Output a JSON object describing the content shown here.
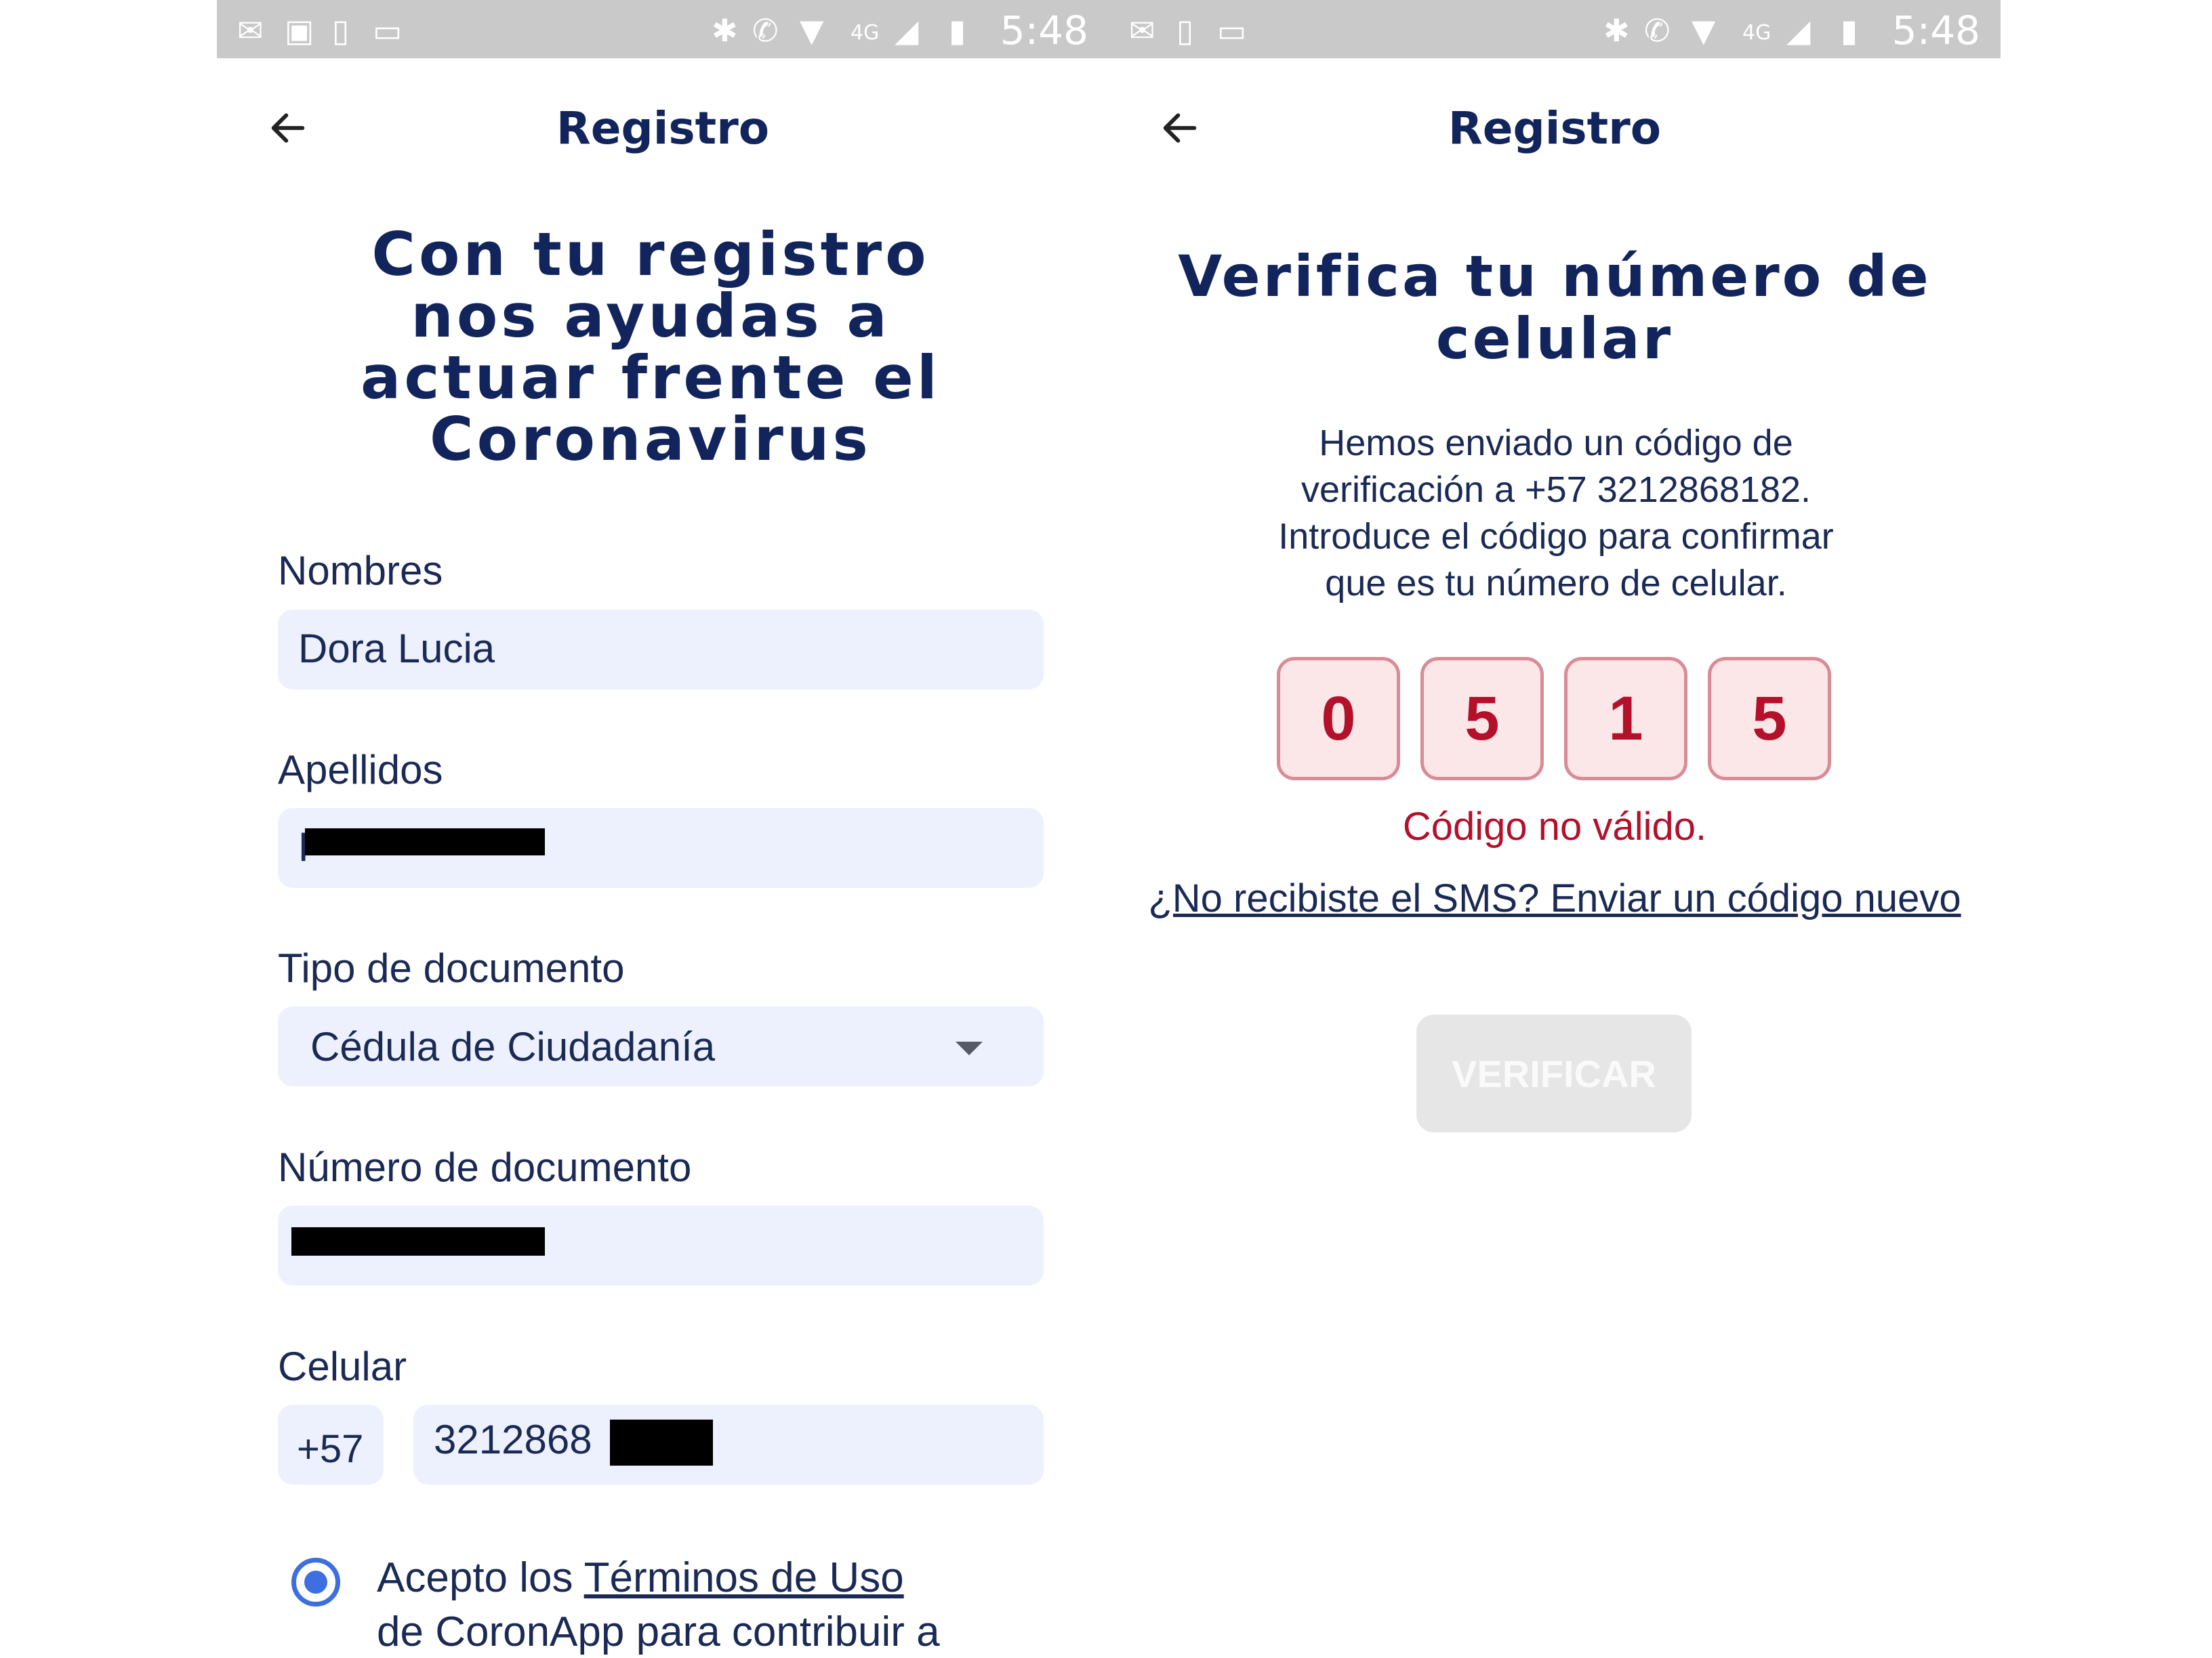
{
  "status_bar": {
    "time": "5:48",
    "network": "4G",
    "icons": [
      "mail-icon",
      "image-icon",
      "phone-icon",
      "laptop-icon",
      "bluetooth-icon",
      "wifi-calling-icon",
      "wifi-icon",
      "signal-icon",
      "battery-icon"
    ]
  },
  "registration_screen": {
    "title": "Registro",
    "headline_lines": [
      "Con tu registro",
      "nos ayudas a",
      "actuar frente el",
      "Coronavirus"
    ],
    "fields": {
      "names": {
        "label": "Nombres",
        "value": "Dora Lucia"
      },
      "surnames": {
        "label": "Apellidos",
        "value": "P"
      },
      "document_type": {
        "label": "Tipo de documento",
        "value": "Cédula de Ciudadanía"
      },
      "document_number": {
        "label": "Número de documento",
        "value": ""
      },
      "phone": {
        "label": "Celular",
        "country_code": "+57",
        "value": "3212868"
      }
    },
    "terms": {
      "prefix": "Acepto los ",
      "link": "Términos de Uso",
      "suffix": "de CoronApp para contribuir a"
    }
  },
  "verification_screen": {
    "title": "Registro",
    "headline_lines": [
      "Verifica tu número de",
      "celular"
    ],
    "description_lines": [
      "Hemos enviado un código de",
      "verificación a +57 3212868182.",
      "Introduce el código para confirmar",
      "que es tu número de celular."
    ],
    "code_digits": [
      "0",
      "5",
      "1",
      "5"
    ],
    "error": "Código no válido.",
    "resend_link": "¿No recibiste el SMS? Enviar un código nuevo",
    "verify_button": "VERIFICAR"
  },
  "colors": {
    "primary_text": "#12245c",
    "field_background": "#edf1fd",
    "error": "#b3102b",
    "code_box_background": "#fbe6e8",
    "code_box_border": "#d98c96",
    "radio_accent": "#3d6fe0",
    "disabled_button": "#e6e6e6",
    "status_bar": "#c9c9c9"
  }
}
